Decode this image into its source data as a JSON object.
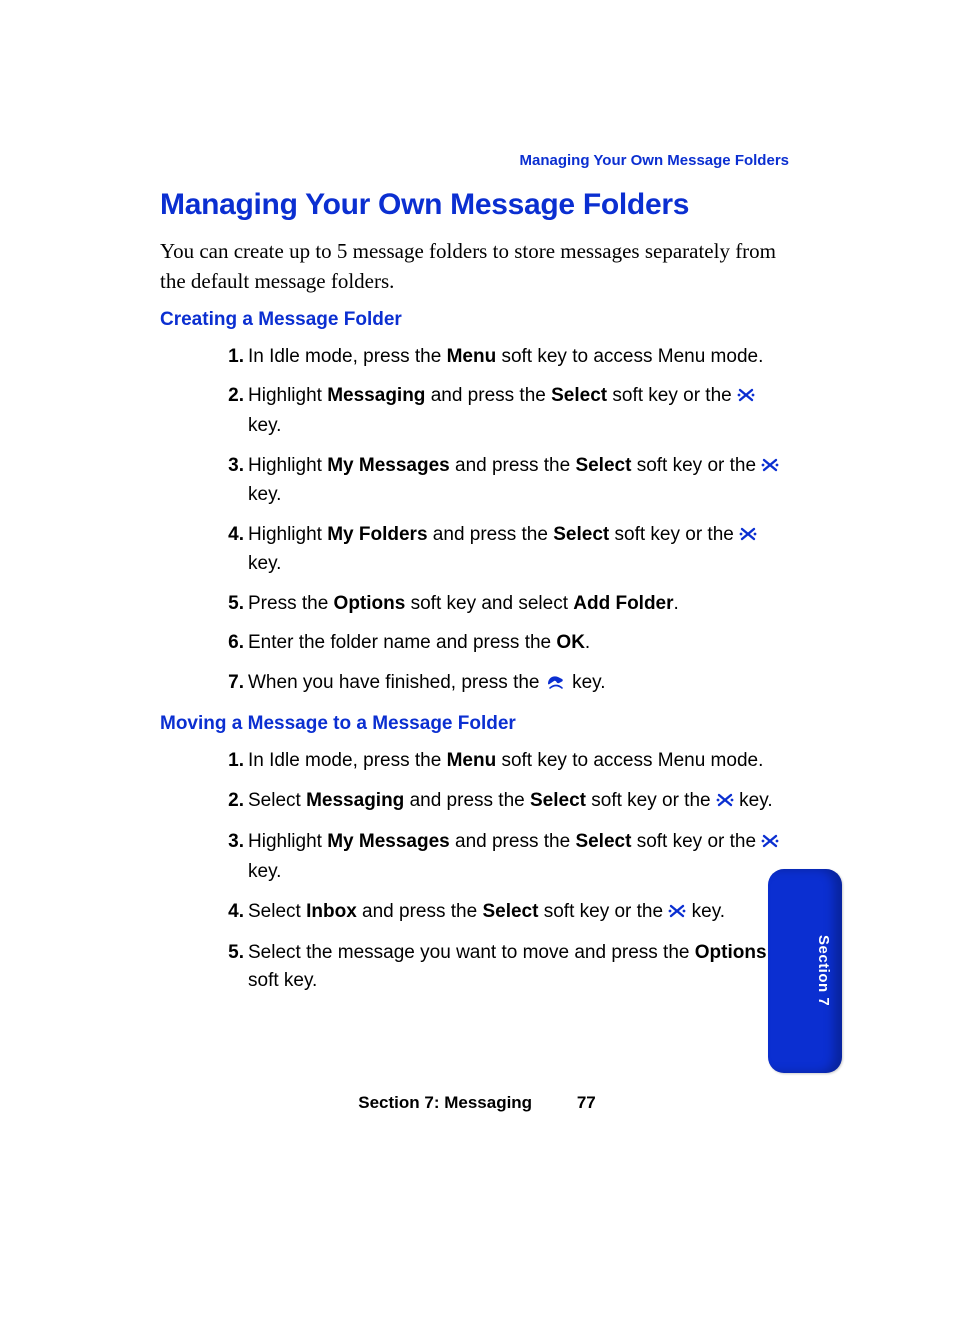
{
  "header": {
    "breadcrumb": "Managing Your Own Message Folders"
  },
  "title": "Managing Your Own Message Folders",
  "intro": "You can create up to 5 message folders to store messages separately from the default message folders.",
  "section1": {
    "heading": "Creating a Message Folder",
    "steps": [
      {
        "n": "1.",
        "parts": [
          "In Idle mode, press the ",
          {
            "b": "Menu"
          },
          " soft key to access Menu mode."
        ]
      },
      {
        "n": "2.",
        "parts": [
          "Highlight ",
          {
            "b": "Messaging"
          },
          " and press the ",
          {
            "b": "Select"
          },
          " soft key or the ",
          {
            "icon": "x"
          },
          " key."
        ]
      },
      {
        "n": "3.",
        "parts": [
          "Highlight ",
          {
            "b": "My Messages"
          },
          " and press the ",
          {
            "b": "Select"
          },
          " soft key or the ",
          {
            "icon": "x"
          },
          " key."
        ]
      },
      {
        "n": "4.",
        "parts": [
          "Highlight ",
          {
            "b": "My Folders"
          },
          " and press the ",
          {
            "b": "Select"
          },
          " soft key or the ",
          {
            "icon": "x"
          },
          " key."
        ]
      },
      {
        "n": "5.",
        "parts": [
          "Press the ",
          {
            "b": "Options"
          },
          " soft key and select ",
          {
            "b": "Add Folder"
          },
          "."
        ]
      },
      {
        "n": "6.",
        "parts": [
          "Enter the folder name and press the ",
          {
            "b": "OK"
          },
          "."
        ]
      },
      {
        "n": "7.",
        "parts": [
          "When you have finished, press the ",
          {
            "icon": "phone"
          },
          " key."
        ]
      }
    ]
  },
  "section2": {
    "heading": "Moving a Message to a Message Folder",
    "steps": [
      {
        "n": "1.",
        "parts": [
          "In Idle mode, press the ",
          {
            "b": "Menu"
          },
          " soft key to access Menu mode."
        ]
      },
      {
        "n": "2.",
        "parts": [
          "Select ",
          {
            "b": "Messaging"
          },
          " and press the ",
          {
            "b": "Select"
          },
          " soft key or the ",
          {
            "icon": "x"
          },
          " key."
        ]
      },
      {
        "n": "3.",
        "parts": [
          "Highlight ",
          {
            "b": "My Messages"
          },
          " and press the ",
          {
            "b": "Select"
          },
          " soft key or the ",
          {
            "icon": "x"
          },
          " key."
        ]
      },
      {
        "n": "4.",
        "parts": [
          "Select ",
          {
            "b": "Inbox"
          },
          " and press the ",
          {
            "b": "Select"
          },
          " soft key or the ",
          {
            "icon": "x"
          },
          " key."
        ]
      },
      {
        "n": "5.",
        "parts": [
          "Select the message you want to move and press the ",
          {
            "b": "Options"
          },
          " soft key."
        ]
      }
    ]
  },
  "sidetab": "Section 7",
  "footer": {
    "section": "Section 7: Messaging",
    "page": "77"
  },
  "icons": {
    "x_name": "confirm-key-icon",
    "phone_name": "end-key-icon"
  }
}
